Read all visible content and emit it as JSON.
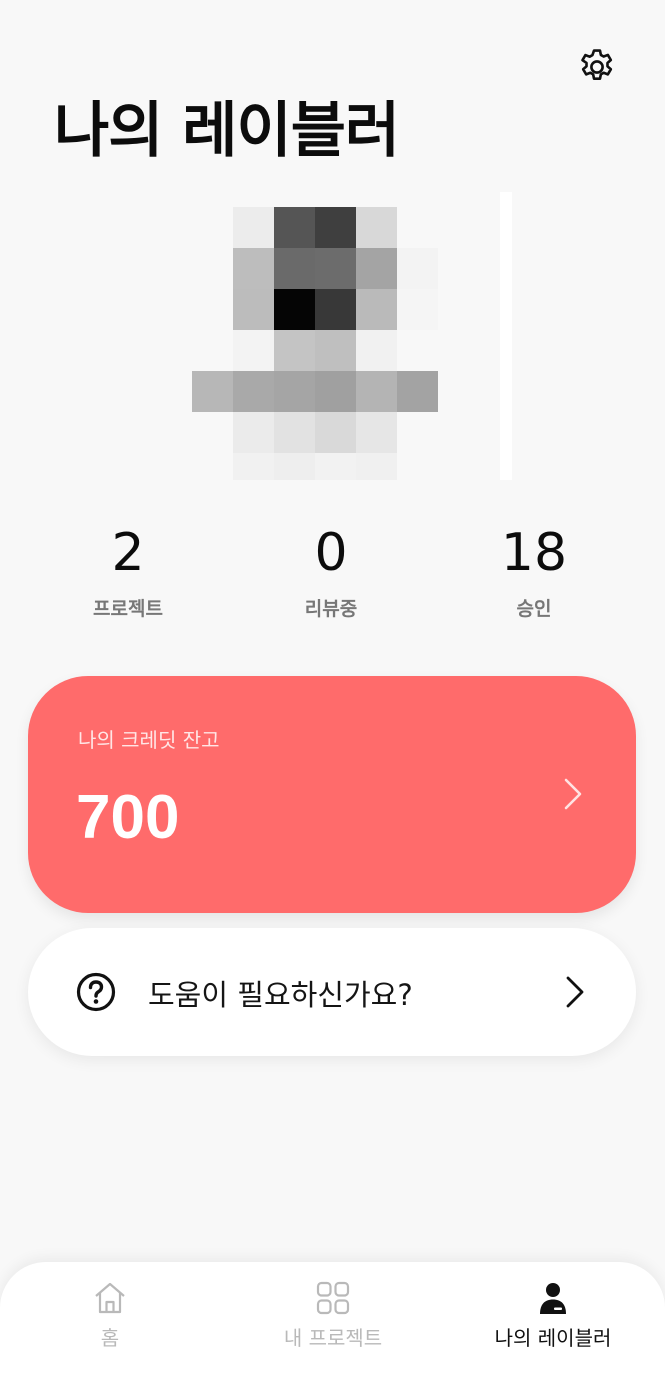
{
  "header": {
    "title": "나의 레이블러",
    "settings_icon": "gear-icon"
  },
  "profile": {
    "avatar_icon": "avatar-image"
  },
  "stats": [
    {
      "value": "2",
      "label": "프로젝트"
    },
    {
      "value": "0",
      "label": "리뷰중"
    },
    {
      "value": "18",
      "label": "승인"
    }
  ],
  "credit": {
    "label": "나의 크레딧 잔고",
    "value": "700",
    "accent": "#ff6b6b",
    "chevron_icon": "chevron-right-icon"
  },
  "help": {
    "icon": "question-circle-icon",
    "text": "도움이 필요하신가요?",
    "chevron_icon": "chevron-right-icon"
  },
  "tabbar": {
    "tabs": [
      {
        "label": "홈",
        "icon": "home-icon",
        "active": false
      },
      {
        "label": "내 프로젝트",
        "icon": "grid-icon",
        "active": false
      },
      {
        "label": "나의 레이블러",
        "icon": "person-icon",
        "active": true
      }
    ]
  }
}
